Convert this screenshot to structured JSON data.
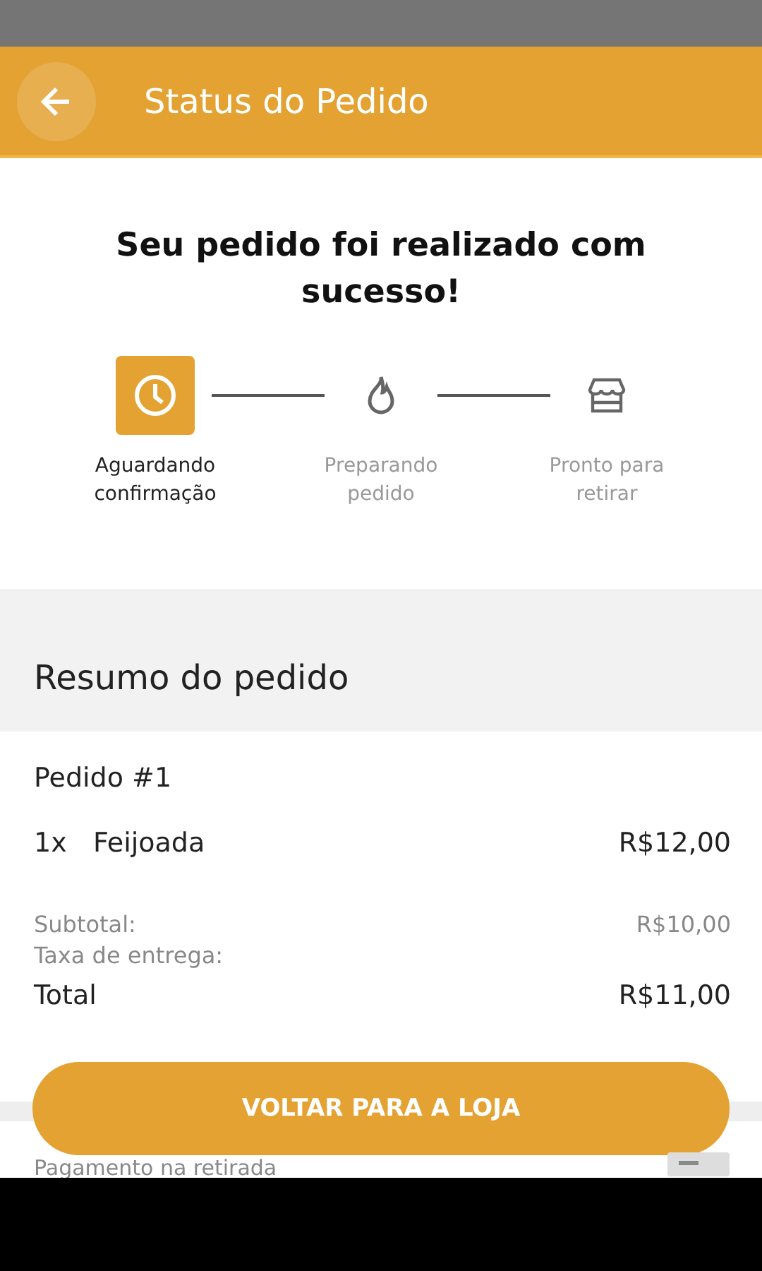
{
  "header": {
    "title": "Status do Pedido"
  },
  "message": "Seu pedido foi realizado com sucesso!",
  "steps": [
    {
      "kind": "clock",
      "label": "Aguardando confirmação",
      "selected": true
    },
    {
      "kind": "flame",
      "label": "Preparando pedido",
      "selected": false
    },
    {
      "kind": "store",
      "label": "Pronto para retirar",
      "selected": false
    }
  ],
  "summary": {
    "title": "Resumo do pedido",
    "order": "Pedido #1",
    "items": [
      {
        "quantity": "1x",
        "name": "Feijoada",
        "price": "R$12,00"
      }
    ],
    "subtotal_label": "Subtotal:",
    "subtotal": "R$10,00",
    "fee_label": "Taxa de entrega:",
    "total_label": "Total",
    "total": "R$11,00"
  },
  "button": "VOLTAR PARA A LOJA",
  "payment": "Pagamento na retirada"
}
